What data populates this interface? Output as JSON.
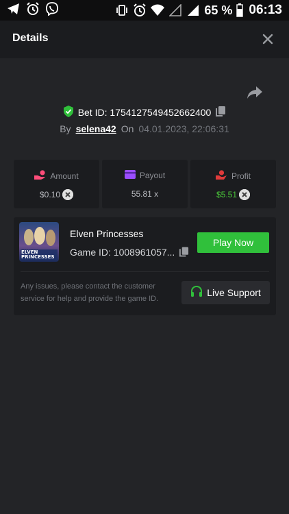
{
  "status_bar": {
    "icons_left": [
      "telegram-icon",
      "alarm-icon",
      "viber-icon"
    ],
    "icons_right": [
      "vibrate-icon",
      "alarm-icon",
      "wifi-icon",
      "signal-empty-icon",
      "signal-icon",
      "battery-icon"
    ],
    "battery_pct": "65 %",
    "time": "06:13"
  },
  "header": {
    "title": "Details"
  },
  "bet": {
    "id_label": "Bet ID: 1754127549452662400",
    "by_label": "By",
    "user": "selena42",
    "on_label": "On",
    "date": "04.01.2023, 22:06:31"
  },
  "stats": [
    {
      "label": "Amount",
      "value": "$0.10",
      "color": "#ff4d7a"
    },
    {
      "label": "Payout",
      "value": "55.81 x",
      "color": "#9b4dff"
    },
    {
      "label": "Profit",
      "value": "$5.51",
      "color": "#e23b3b"
    }
  ],
  "game": {
    "name": "Elven Princesses",
    "id_text": "Game ID: 1008961057...",
    "thumb_text_1": "ELVEN",
    "thumb_text_2": "PRINCESSES",
    "play_label": "Play Now",
    "issues_text": "Any issues, please contact the customer service for help and provide the game ID.",
    "support_label": "Live Support"
  },
  "colors": {
    "accent_green": "#30c03b",
    "profit_green": "#4ac73a"
  }
}
